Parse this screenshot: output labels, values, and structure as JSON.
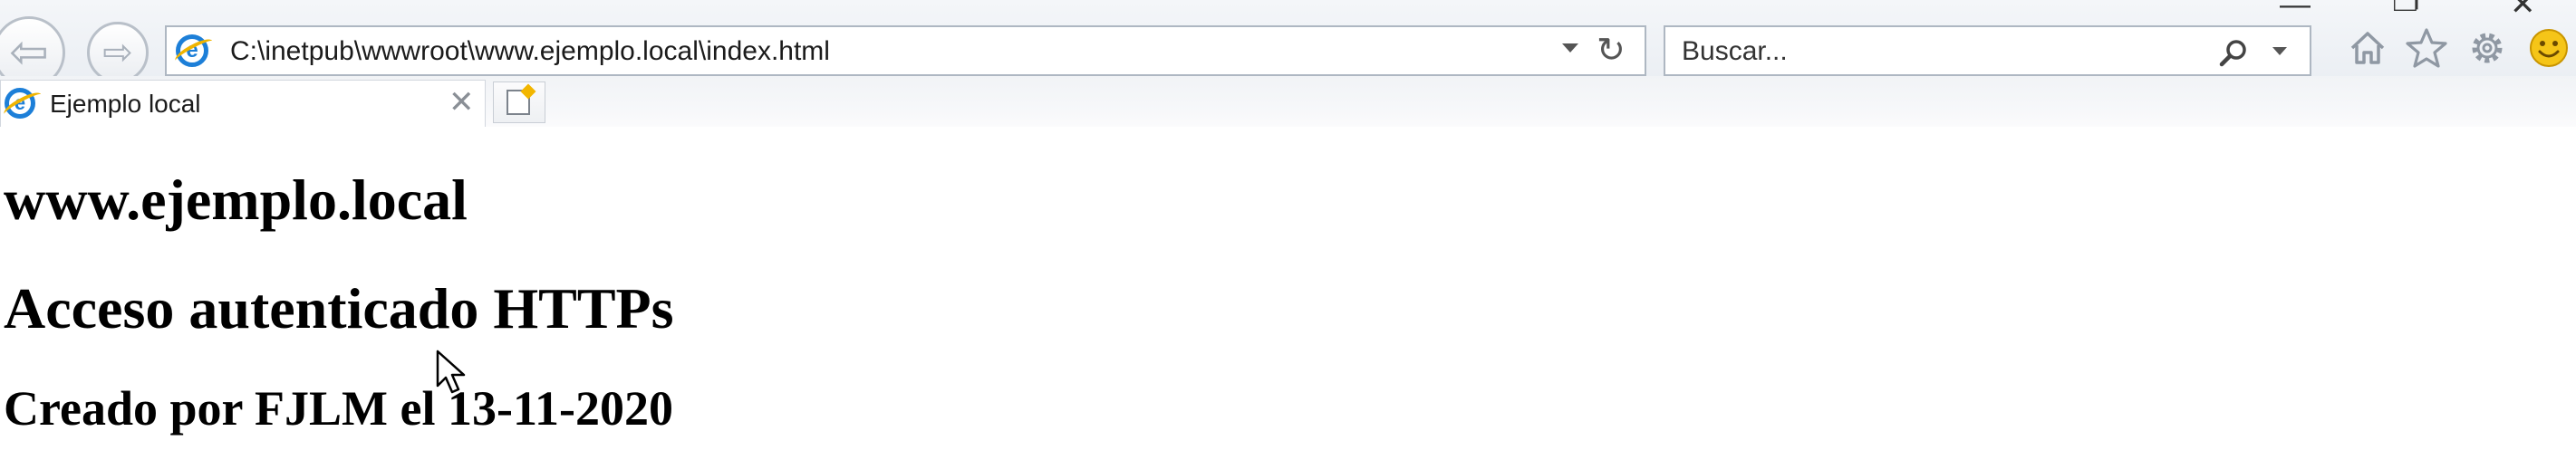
{
  "browser": {
    "address": {
      "url": "C:\\inetpub\\wwwroot\\www.ejemplo.local\\index.html",
      "site_icon": "ie-icon"
    },
    "search": {
      "placeholder": "Buscar..."
    },
    "toolbar_icons": [
      "home-icon",
      "favorites-star-icon",
      "tools-gear-icon",
      "smiley-feedback-icon"
    ],
    "window_controls": [
      "minimize-icon",
      "restore-icon",
      "close-icon"
    ],
    "accent_color": "#1d7fd8"
  },
  "tab": {
    "title": "Ejemplo local",
    "close_glyph": "✕"
  },
  "page": {
    "site_heading": "www.ejemplo.local",
    "access_heading": "Acceso autenticado HTTPs",
    "created_heading": "Creado por FJLM el 13-11-2020"
  }
}
